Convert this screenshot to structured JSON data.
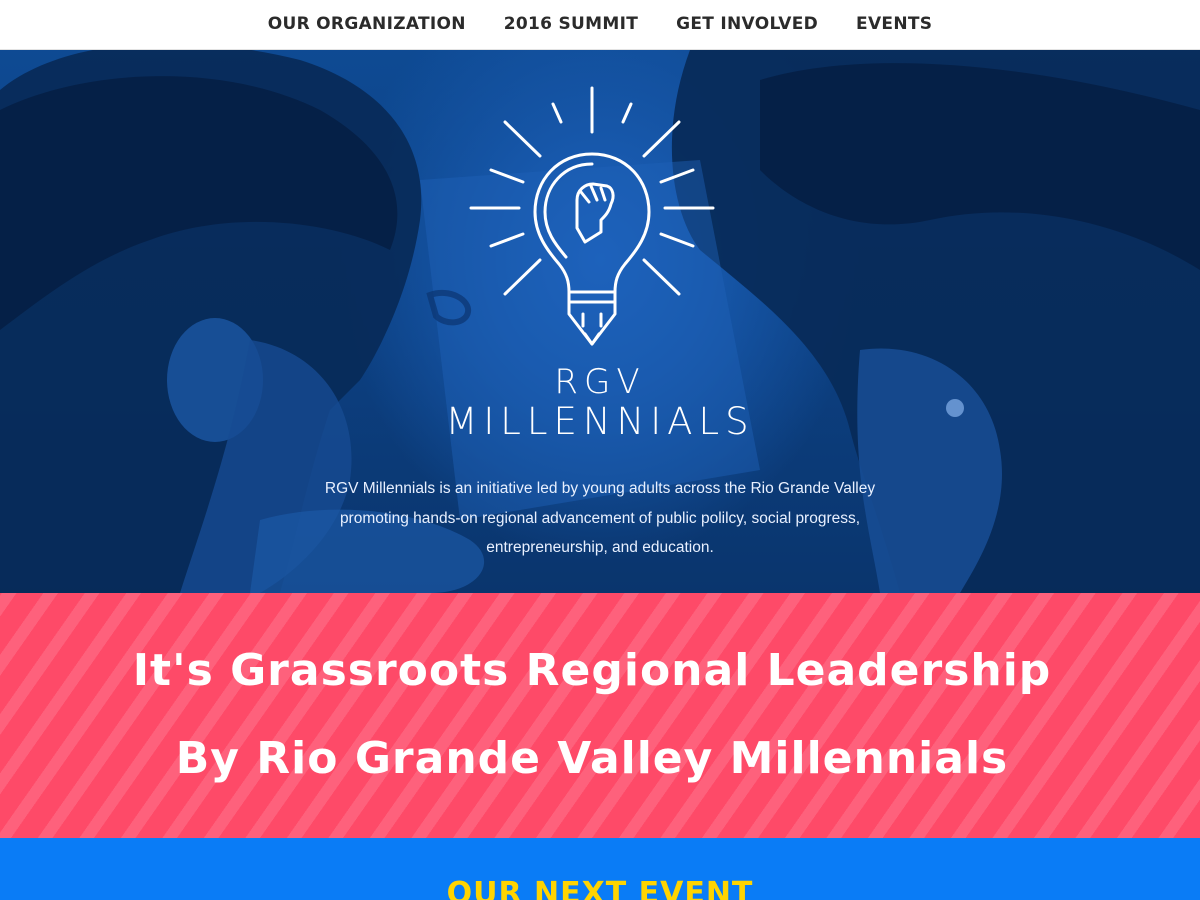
{
  "nav": {
    "items": [
      {
        "label": "OUR ORGANIZATION"
      },
      {
        "label": "2016 SUMMIT"
      },
      {
        "label": "GET INVOLVED"
      },
      {
        "label": "EVENTS"
      }
    ]
  },
  "hero": {
    "logo": {
      "line1": "RGV",
      "line2": "MILLENNIALS",
      "icon": "lightbulb-fist-icon"
    },
    "description": "RGV Millennials is an initiative led by young adults across the Rio Grande Valley promoting hands-on regional advancement of public polilcy, social progress, entrepreneurship, and education."
  },
  "banner": {
    "line1": "It's Grassroots Regional Leadership",
    "line2": "By Rio Grande Valley Millennials"
  },
  "next_event": {
    "title": "OUR NEXT EVENT"
  },
  "colors": {
    "hero_blue": "#0e4a93",
    "banner_pink": "#fe4a68",
    "next_blue": "#0a7cf6",
    "accent_yellow": "#ffd400"
  }
}
